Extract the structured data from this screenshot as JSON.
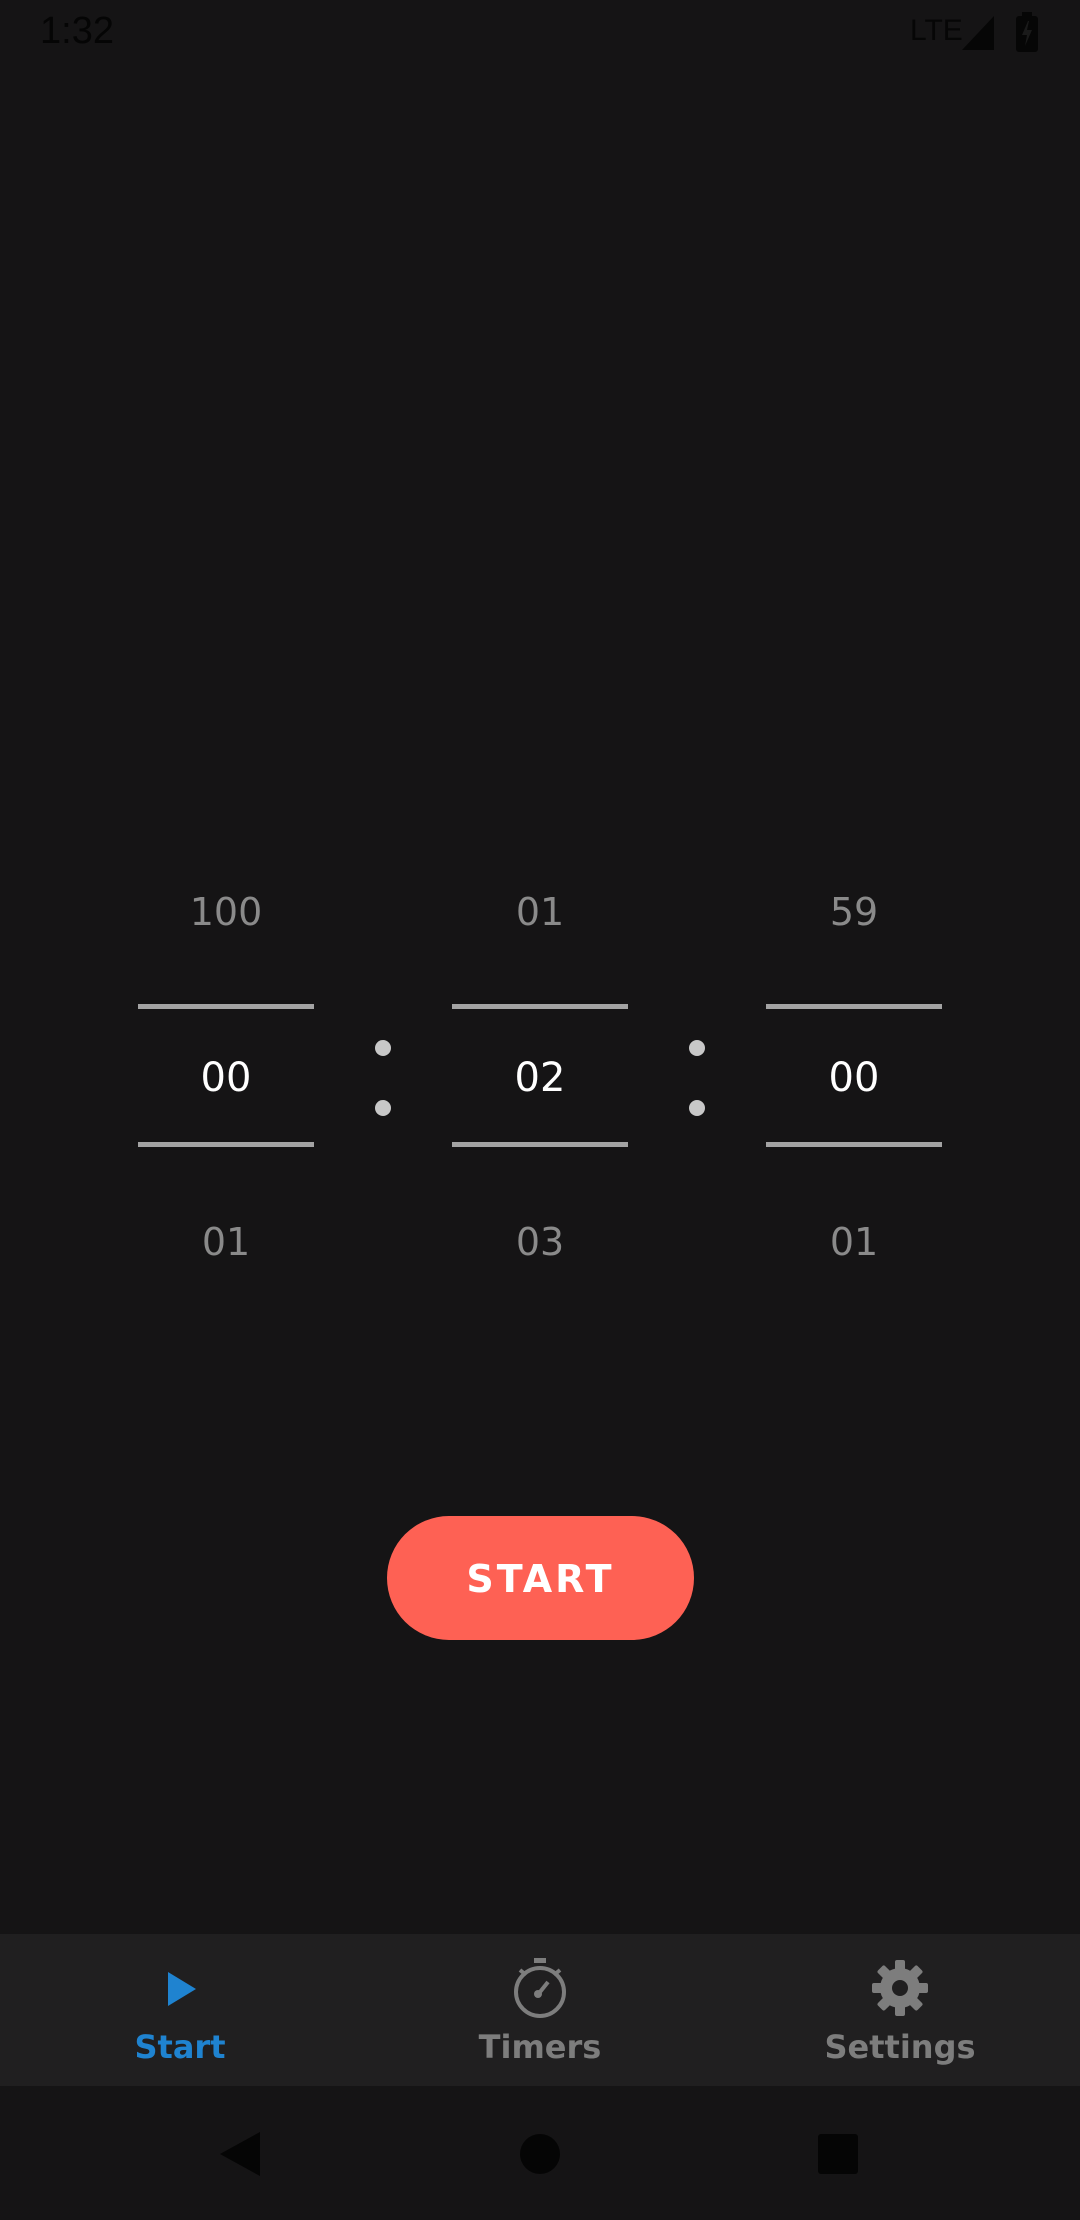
{
  "status_bar": {
    "time": "1:32",
    "network": "LTE"
  },
  "picker": {
    "hours": {
      "prev": "100",
      "current": "00",
      "next": "01"
    },
    "minutes": {
      "prev": "01",
      "current": "02",
      "next": "03"
    },
    "seconds": {
      "prev": "59",
      "current": "00",
      "next": "01"
    }
  },
  "start_button": {
    "label": "START"
  },
  "bottom_nav": {
    "items": [
      {
        "label": "Start",
        "icon": "play-icon",
        "active": true
      },
      {
        "label": "Timers",
        "icon": "stopwatch-icon",
        "active": false
      },
      {
        "label": "Settings",
        "icon": "gear-icon",
        "active": false
      }
    ]
  },
  "system_nav": {
    "buttons": [
      "back-icon",
      "home-icon",
      "recents-icon"
    ]
  },
  "colors": {
    "background": "#151415",
    "accent_start": "#fe6154",
    "active_nav": "#1f83d0",
    "inactive_nav": "#7d7d7d",
    "nav_bar": "#201f20"
  }
}
